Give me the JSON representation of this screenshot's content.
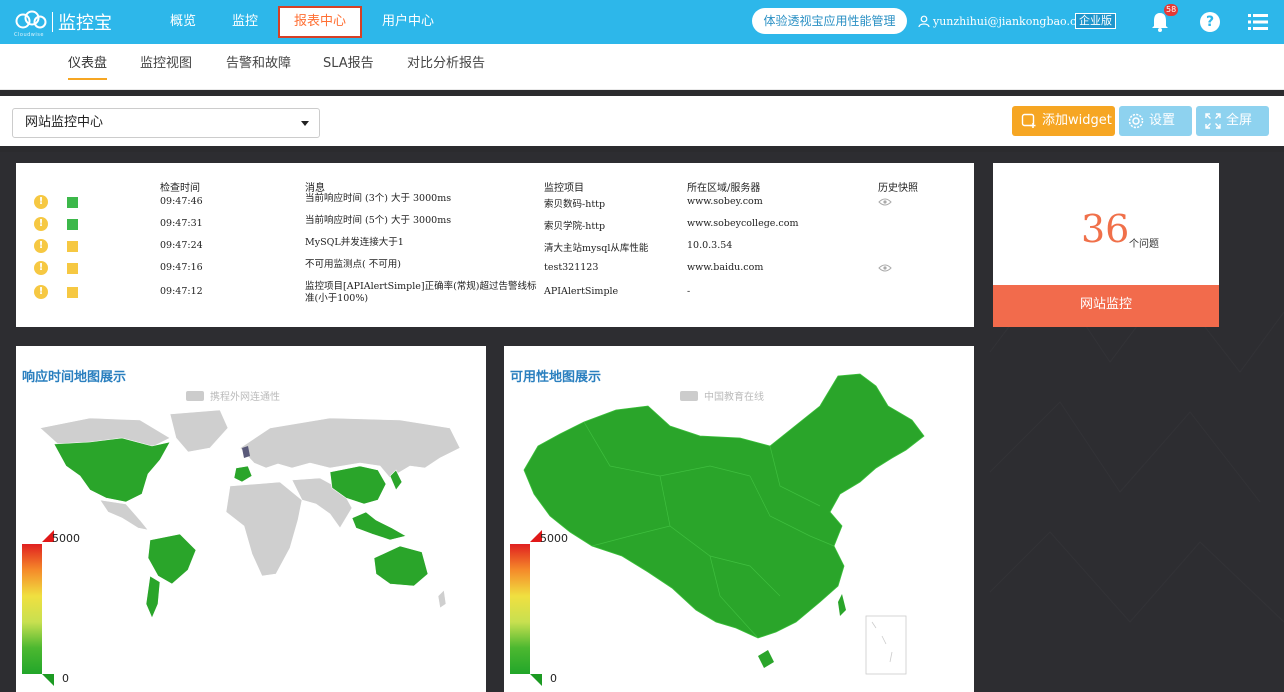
{
  "app": {
    "logo_text": "监控宝",
    "logo_sub": "Cloudwise"
  },
  "topnav": {
    "items": [
      {
        "label": "概览"
      },
      {
        "label": "监控"
      },
      {
        "label": "报表中心"
      },
      {
        "label": "用户中心"
      }
    ],
    "active": "报表中心",
    "trial_button": "体验透视宝应用性能管理",
    "username": "yunzhihui@jiankongbao.com",
    "edition_badge": "企业版",
    "notification_count": "58",
    "help_label": "?"
  },
  "subnav": {
    "items": [
      {
        "label": "仪表盘"
      },
      {
        "label": "监控视图"
      },
      {
        "label": "告警和故障"
      },
      {
        "label": "SLA报告"
      },
      {
        "label": "对比分析报告"
      }
    ],
    "active": "仪表盘"
  },
  "toolbar": {
    "selected_dashboard": "网站监控中心",
    "add_widget_label": "添加widget",
    "settings_label": "设置",
    "fullscreen_label": "全屏"
  },
  "alerts": {
    "headers": {
      "time": "检查时间",
      "message": "消息",
      "item": "监控项目",
      "location": "所在区域/服务器",
      "snapshot": "历史快照"
    },
    "rows": [
      {
        "time": "09:47:46",
        "message": "当前响应时间 (3个) 大于 3000ms",
        "message2": "",
        "item": "索贝数码-http",
        "location": "www.sobey.com",
        "level_color": "#3cb84a",
        "has_snapshot": true
      },
      {
        "time": "09:47:31",
        "message": "当前响应时间 (5个) 大于 3000ms",
        "message2": "",
        "item": "索贝学院-http",
        "location": "www.sobeycollege.com",
        "level_color": "#3cb84a",
        "has_snapshot": false
      },
      {
        "time": "09:47:24",
        "message": "MySQL并发连接大于1",
        "message2": "",
        "item": "清大主站mysql从库性能",
        "location": "10.0.3.54",
        "level_color": "#f6c842",
        "has_snapshot": false
      },
      {
        "time": "09:47:16",
        "message": "不可用监测点( 不可用)",
        "message2": "",
        "item": "test321123",
        "location": "www.baidu.com",
        "level_color": "#f6c842",
        "has_snapshot": true
      },
      {
        "time": "09:47:12",
        "message": "监控项目[APIAlertSimple]正确率(常规)超过告警线标",
        "message2": "准(小于100%)",
        "item": "APIAlertSimple",
        "location": "-",
        "level_color": "#f6c842",
        "has_snapshot": false
      }
    ]
  },
  "issues": {
    "count": "36",
    "unit": "个问题",
    "footer": "网站监控"
  },
  "maps": {
    "response": {
      "title": "响应时间地图展示",
      "legend": "携程外网连通性",
      "scale_max": "5000",
      "scale_min": "0"
    },
    "availability": {
      "title": "可用性地图展示",
      "legend": "中国教育在线",
      "scale_max": "5000",
      "scale_min": "0"
    }
  },
  "colors": {
    "brand": "#2db7ea",
    "active_nav_text": "#ff6f33",
    "map_green": "#2aa52a",
    "map_grey": "#cfcfcf",
    "issues_accent": "#f26b4c"
  }
}
